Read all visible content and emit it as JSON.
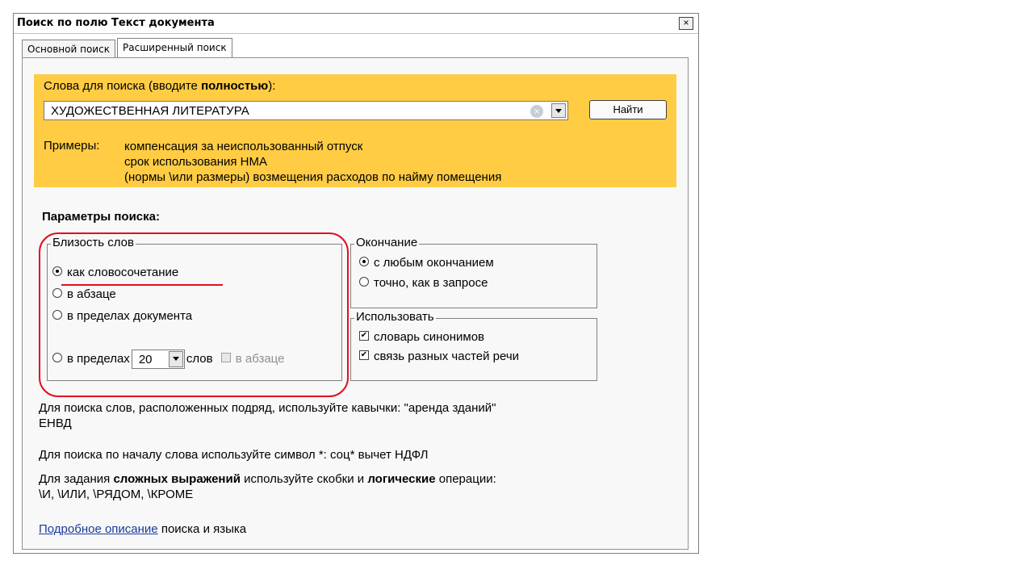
{
  "window": {
    "title": "Поиск по полю Текст документа",
    "close_glyph": "×"
  },
  "tabs": [
    {
      "label": "Основной поиск",
      "active": false
    },
    {
      "label": "Расширенный поиск",
      "active": true
    }
  ],
  "search": {
    "label_prefix": "Слова для поиска (вводите ",
    "label_bold": "полностью",
    "label_suffix": "):",
    "value": "ХУДОЖЕСТВЕННАЯ ЛИТЕРАТУРА",
    "clear_glyph": "×",
    "find_label": "Найти",
    "examples_label": "Примеры:",
    "examples": [
      "компенсация за неиспользованный отпуск",
      "срок использования НМА",
      "(нормы \\или размеры) возмещения расходов по найму помещения"
    ]
  },
  "params": {
    "title": "Параметры поиска:",
    "proximity": {
      "legend": "Близость слов",
      "options": [
        {
          "label": "как словосочетание",
          "selected": true
        },
        {
          "label": "в абзаце",
          "selected": false
        },
        {
          "label": "в пределах документа",
          "selected": false
        }
      ],
      "within_label": "в пределах",
      "within_value": "20",
      "words_label": "слов",
      "in_paragraph_label": "в абзаце"
    },
    "ending": {
      "legend": "Окончание",
      "options": [
        {
          "label": "с любым окончанием",
          "selected": true
        },
        {
          "label": "точно, как в запросе",
          "selected": false
        }
      ]
    },
    "use": {
      "legend": "Использовать",
      "options": [
        {
          "label": "словарь синонимов",
          "checked": true
        },
        {
          "label": "связь разных частей речи",
          "checked": true
        }
      ]
    }
  },
  "help": {
    "quotes_line1": "Для поиска слов, расположенных подряд, используйте кавычки: \"аренда зданий\"",
    "quotes_line2": "ЕНВД",
    "prefix_line": "Для поиска по началу слова используйте символ *: соц* вычет НДФЛ",
    "complex_a": "Для задания ",
    "complex_b": "сложных выражений",
    "complex_c": " используйте скобки и ",
    "complex_d": "логические",
    "complex_e": " операции:",
    "operators": "\\И, \\ИЛИ, \\РЯДОМ, \\КРОМЕ",
    "details_link": "Подробное описание",
    "details_rest": " поиска и языка"
  },
  "colors": {
    "highlight_panel": "#ffcc44",
    "annotation_red": "#e01020",
    "link_blue": "#1a3a9a"
  }
}
